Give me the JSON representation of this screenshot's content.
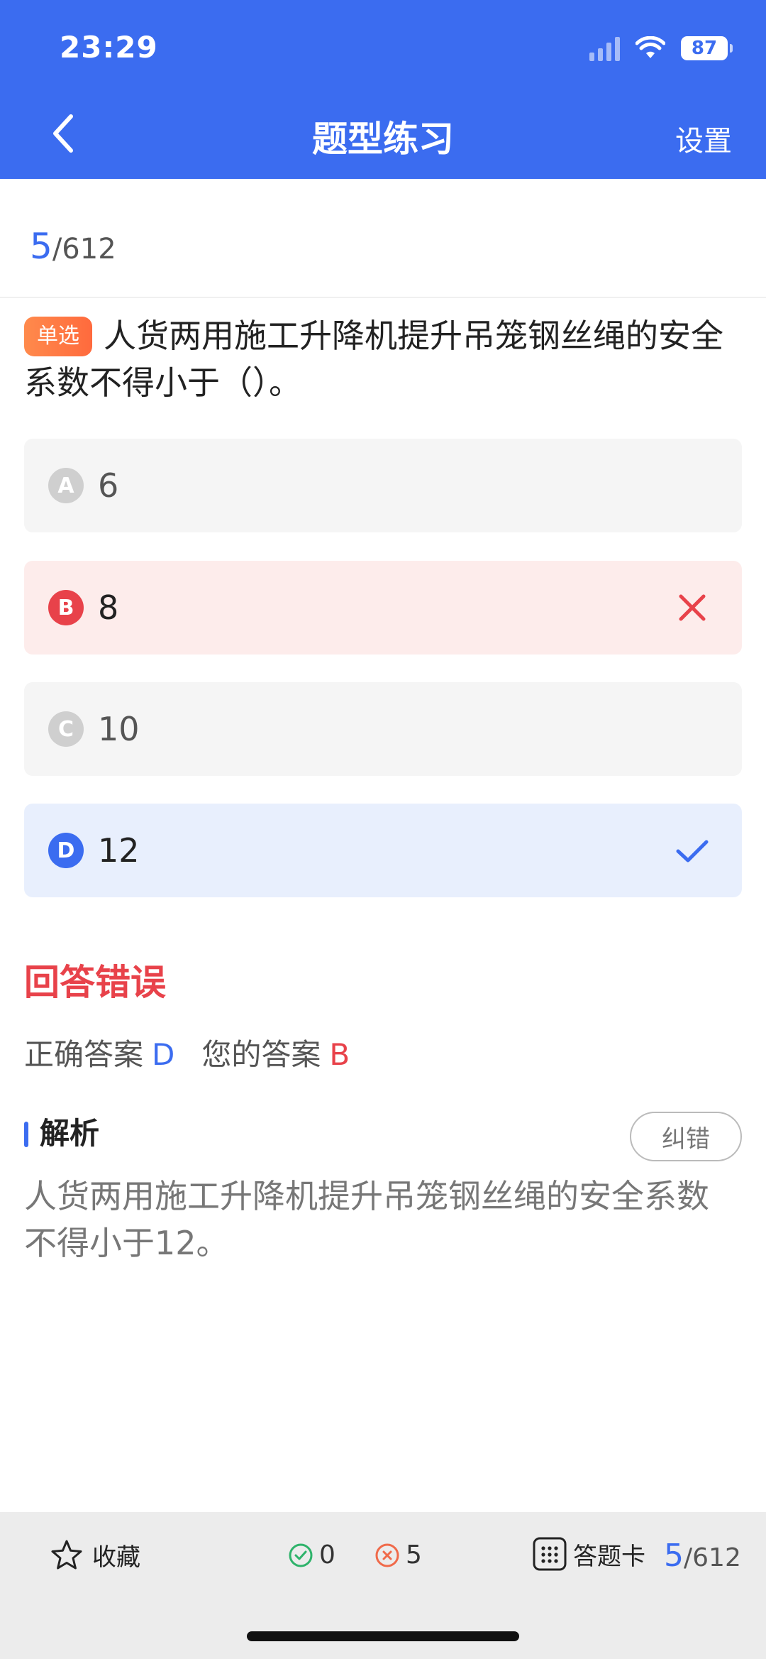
{
  "status": {
    "time": "23:29",
    "battery": "87"
  },
  "header": {
    "title": "题型练习",
    "settings_label": "设置"
  },
  "progress": {
    "current": "5",
    "total": "/612"
  },
  "question": {
    "type_badge": "单选",
    "text": "人货两用施工升降机提升吊笼钢丝绳的安全系数不得小于（）。"
  },
  "options": [
    {
      "letter": "A",
      "text": "6",
      "state": "normal"
    },
    {
      "letter": "B",
      "text": "8",
      "state": "wrong"
    },
    {
      "letter": "C",
      "text": "10",
      "state": "normal"
    },
    {
      "letter": "D",
      "text": "12",
      "state": "correct"
    }
  ],
  "result": {
    "title": "回答错误",
    "correct_label": "正确答案",
    "correct_value": "D",
    "yours_label": "您的答案",
    "yours_value": "B"
  },
  "analysis": {
    "title": "解析",
    "report_label": "纠错",
    "text": "人货两用施工升降机提升吊笼钢丝绳的安全系数不得小于12。"
  },
  "bottom_bar": {
    "favorite_label": "收藏",
    "correct_count": "0",
    "wrong_count": "5",
    "answer_card_label": "答题卡",
    "current": "5",
    "total": "/612"
  },
  "colors": {
    "primary": "#3b6cf0",
    "error": "#e8424a",
    "success": "#2fb36b",
    "badge": "#ff7a45"
  },
  "icons": [
    "back-icon",
    "signal-icon",
    "wifi-icon",
    "battery-icon",
    "close-icon",
    "check-icon",
    "star-icon",
    "check-circle-icon",
    "x-circle-icon",
    "grid-icon"
  ]
}
